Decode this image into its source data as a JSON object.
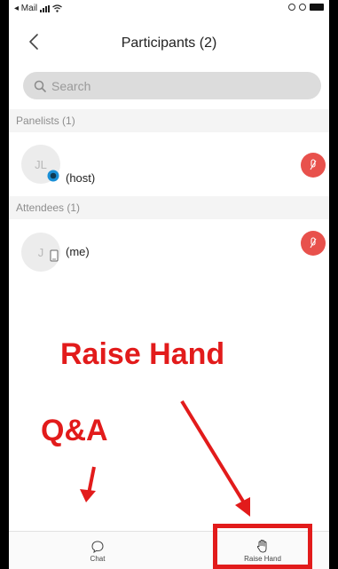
{
  "status_bar": {
    "back_app": "◂ Mail"
  },
  "nav": {
    "title": "Participants (2)"
  },
  "search": {
    "placeholder": "Search"
  },
  "sections": {
    "panelists": "Panelists (1)",
    "attendees": "Attendees (1)"
  },
  "participants": [
    {
      "initials": "JL",
      "label": "(host)"
    },
    {
      "initials": "J",
      "label": "(me)"
    }
  ],
  "annotations": {
    "raise_hand": "Raise Hand",
    "qa": "Q&A"
  },
  "tabs": {
    "chat": "Chat",
    "raise_hand": "Raise Hand"
  },
  "colors": {
    "accent_red": "#e21b1b",
    "mic_red": "#e8514c",
    "host_badge": "#1a8fd6"
  }
}
